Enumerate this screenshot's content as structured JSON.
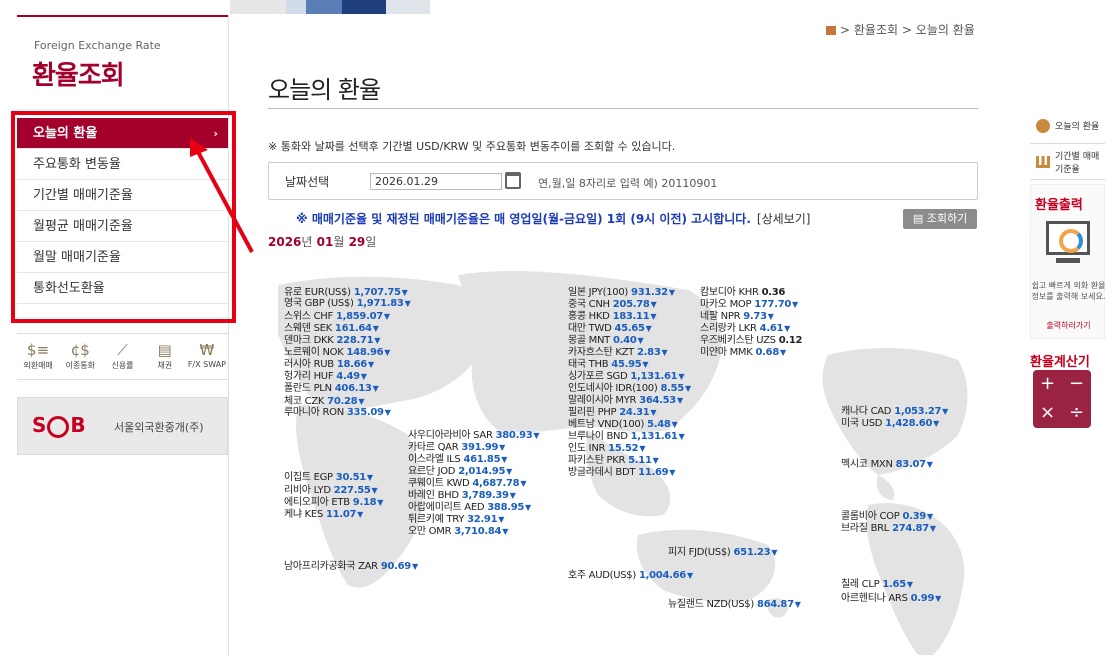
{
  "sidebar": {
    "subtitle": "Foreign Exchange Rate",
    "title": "환율조회",
    "menu": [
      "오늘의 환율",
      "주요통화 변동율",
      "기간별 매매기준율",
      "월평균 매매기준율",
      "월말 매매기준율",
      "통화선도환율"
    ],
    "quick": [
      "외환매매",
      "이종통화",
      "신용률",
      "채권",
      "F/X SWAP"
    ],
    "smb_logo": "SMB",
    "smb_name": "서울외국환중개(주)"
  },
  "breadcrumb": {
    "a": "환율조회",
    "b": "오늘의 환율",
    "sep": ">"
  },
  "page_title": "오늘의 환율",
  "note": "※ 통화와 날짜를 선택후 기간별 USD/KRW 및 주요통화 변동추이를 조회할 수 있습니다.",
  "date_field": {
    "label": "날짜선택",
    "value": "2026.01.29",
    "hint": "연,월,일 8자리로 입력 예) 20110901"
  },
  "notice": {
    "text": "※ 매매기준율 및 재정된 매매기준율은 매 영업일(월-금요일) 1회 (9시 이전) 고시합니다.",
    "more": "[상세보기]"
  },
  "search_btn": "조회하기",
  "date_label": {
    "y": "2026",
    "yl": "년",
    "m": "01",
    "ml": "월",
    "d": "29",
    "dl": "일"
  },
  "rates": [
    {
      "n": "유로 EUR(US$)",
      "v": "1,707.75",
      "a": "▼"
    },
    {
      "n": "영국 GBP (US$)",
      "v": "1,971.83",
      "a": "▼"
    },
    {
      "n": "스위스 CHF",
      "v": "1,859.07",
      "a": "▼"
    },
    {
      "n": "스웨덴 SEK",
      "v": "161.64",
      "a": "▼"
    },
    {
      "n": "덴마크 DKK",
      "v": "228.71",
      "a": "▼"
    },
    {
      "n": "노르웨이 NOK",
      "v": "148.96",
      "a": "▼"
    },
    {
      "n": "러시아 RUB",
      "v": "18.66",
      "a": "▼"
    },
    {
      "n": "헝가리 HUF",
      "v": "4.49",
      "a": "▼"
    },
    {
      "n": "폴란드 PLN",
      "v": "406.13",
      "a": "▼"
    },
    {
      "n": "체코 CZK",
      "v": "70.28",
      "a": "▼"
    },
    {
      "n": "루마니아 RON",
      "v": "335.09",
      "a": "▼"
    },
    {
      "n": "일본 JPY(100)",
      "v": "931.32",
      "a": "▼"
    },
    {
      "n": "중국 CNH",
      "v": "205.78",
      "a": "▼"
    },
    {
      "n": "홍콩 HKD",
      "v": "183.11",
      "a": "▼"
    },
    {
      "n": "대만 TWD",
      "v": "45.65",
      "a": "▼"
    },
    {
      "n": "몽골 MNT",
      "v": "0.40",
      "a": "▼"
    },
    {
      "n": "카자흐스탄 KZT",
      "v": "2.83",
      "a": "▼"
    },
    {
      "n": "태국 THB",
      "v": "45.95",
      "a": "▼"
    },
    {
      "n": "싱가포르 SGD",
      "v": "1,131.61",
      "a": "▼"
    },
    {
      "n": "인도네시아 IDR(100)",
      "v": "8.55",
      "a": "▼"
    },
    {
      "n": "말레이시아 MYR",
      "v": "364.53",
      "a": "▼"
    },
    {
      "n": "필리핀 PHP",
      "v": "24.31",
      "a": "▼"
    },
    {
      "n": "베트남 VND(100)",
      "v": "5.48",
      "a": "▼"
    },
    {
      "n": "브루나이 BND",
      "v": "1,131.61",
      "a": "▼"
    },
    {
      "n": "인도 INR",
      "v": "15.52",
      "a": "▼"
    },
    {
      "n": "파키스탄 PKR",
      "v": "5.11",
      "a": "▼"
    },
    {
      "n": "방글라데시 BDT",
      "v": "11.69",
      "a": "▼"
    },
    {
      "n": "캄보디아 KHR",
      "v": "0.36",
      "a": ""
    },
    {
      "n": "마카오 MOP",
      "v": "177.70",
      "a": "▼"
    },
    {
      "n": "네팔 NPR",
      "v": "9.73",
      "a": "▼"
    },
    {
      "n": "스리랑카 LKR",
      "v": "4.61",
      "a": "▼"
    },
    {
      "n": "우즈베키스탄 UZS",
      "v": "0.12",
      "a": ""
    },
    {
      "n": "미얀마 MMK",
      "v": "0.68",
      "a": "▼"
    },
    {
      "n": "사우디아라비아 SAR",
      "v": "380.93",
      "a": "▼"
    },
    {
      "n": "카타르 QAR",
      "v": "391.99",
      "a": "▼"
    },
    {
      "n": "이스라엘 ILS",
      "v": "461.85",
      "a": "▼"
    },
    {
      "n": "요르단 JOD",
      "v": "2,014.95",
      "a": "▼"
    },
    {
      "n": "쿠웨이트 KWD",
      "v": "4,687.78",
      "a": "▼"
    },
    {
      "n": "바레인 BHD",
      "v": "3,789.39",
      "a": "▼"
    },
    {
      "n": "아랍에미리트 AED",
      "v": "388.95",
      "a": "▼"
    },
    {
      "n": "튀르키예 TRY",
      "v": "32.91",
      "a": "▼"
    },
    {
      "n": "오만 OMR",
      "v": "3,710.84",
      "a": "▼"
    },
    {
      "n": "이집트 EGP",
      "v": "30.51",
      "a": "▼"
    },
    {
      "n": "리비아 LYD",
      "v": "227.55",
      "a": "▼"
    },
    {
      "n": "에티오피아 ETB",
      "v": "9.18",
      "a": "▼"
    },
    {
      "n": "케냐 KES",
      "v": "11.07",
      "a": "▼"
    },
    {
      "n": "남아프리카공화국 ZAR",
      "v": "90.69",
      "a": "▼"
    },
    {
      "n": "캐나다 CAD",
      "v": "1,053.27",
      "a": "▼"
    },
    {
      "n": "미국 USD",
      "v": "1,428.60",
      "a": "▼"
    },
    {
      "n": "멕시코 MXN",
      "v": "83.07",
      "a": "▼"
    },
    {
      "n": "콜롬비아 COP",
      "v": "0.39",
      "a": "▼"
    },
    {
      "n": "브라질 BRL",
      "v": "274.87",
      "a": "▼"
    },
    {
      "n": "칠레 CLP",
      "v": "1.65",
      "a": "▼"
    },
    {
      "n": "아르헨티나 ARS",
      "v": "0.99",
      "a": "▼"
    },
    {
      "n": "피지 FJD(US$)",
      "v": "651.23",
      "a": "▼"
    },
    {
      "n": "호주 AUD(US$)",
      "v": "1,004.66",
      "a": "▼"
    },
    {
      "n": "뉴질랜드 NZD(US$)",
      "v": "864.87",
      "a": "▼"
    }
  ],
  "right": {
    "today": "오늘의 환율",
    "period": "기간별 매매기준율",
    "print_title": "환율출력",
    "print_text": "쉽고 빠르게 외화 환율정보를 출력해 보세요.",
    "print_go": "출력하러가기",
    "calc_title": "환율계산기",
    "calc_keys": [
      "+",
      "−",
      "×",
      "÷"
    ]
  },
  "colors": {
    "brand": "#a3002b",
    "highlight": "#e60012",
    "rate_value": "#1b5ebd"
  }
}
